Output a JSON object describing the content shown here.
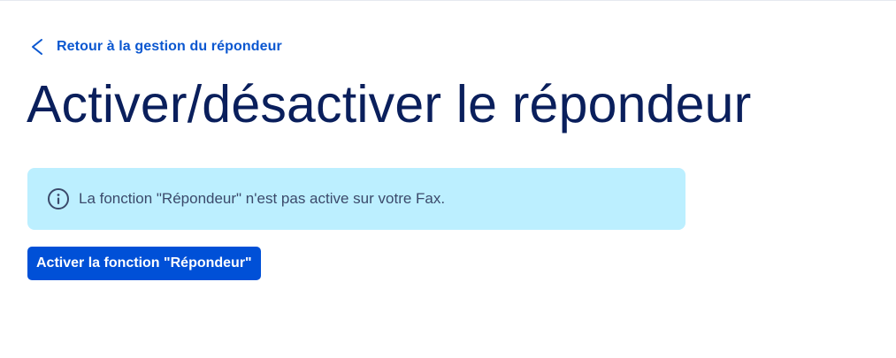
{
  "back_link": {
    "label": "Retour à la gestion du répondeur",
    "icon": "chevron-left-icon"
  },
  "page": {
    "title": "Activer/désactiver le répondeur"
  },
  "info_banner": {
    "icon": "info-icon",
    "message": "La fonction \"Répondeur\" n'est pas active sur votre Fax."
  },
  "actions": {
    "activate_label": "Activer la fonction \"Répondeur\""
  },
  "colors": {
    "link": "#0b57d0",
    "title": "#0a1f5c",
    "banner_background": "#bcefff",
    "banner_text": "#3b4a6b",
    "button_background": "#0050d7",
    "button_text": "#ffffff"
  }
}
